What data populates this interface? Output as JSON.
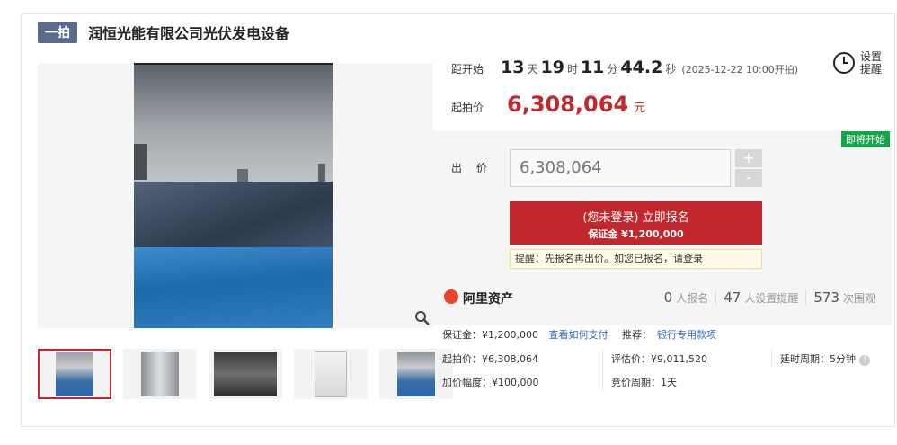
{
  "header": {
    "badge": "一拍",
    "title": "润恒光能有限公司光伏发电设备"
  },
  "countdown": {
    "label": "距开始",
    "days": "13",
    "days_unit": "天",
    "hours": "19",
    "hours_unit": "时",
    "minutes": "11",
    "minutes_unit": "分",
    "seconds": "44.2",
    "seconds_unit": "秒",
    "start_time": "(2025-12-22 10:00开拍)"
  },
  "reminder": {
    "line1": "设置",
    "line2": "提醒"
  },
  "start_price": {
    "label": "起拍价",
    "value": "6,308,064",
    "unit": "元"
  },
  "bid": {
    "status_badge": "即将开始",
    "label": "出 价",
    "input_value": "6,308,064",
    "plus": "+",
    "minus": "-",
    "signup_line1": "(您未登录) 立即报名",
    "signup_line2": "保证金 ¥1,200,000",
    "tip_text": "提醒：先报名再出价。如您已报名，请",
    "tip_link": "登录"
  },
  "platform": {
    "name": "阿里资产",
    "signups_count": "0",
    "signups_label": "人报名",
    "reminders_count": "47",
    "reminders_label": "人设置提醒",
    "views_count": "573",
    "views_label": "次围观"
  },
  "details": {
    "deposit": "保证金：¥1,200,000",
    "how_to_pay": "查看如何支付",
    "recommend_label": "推荐：",
    "recommend_link": "银行专用款项",
    "start_price": "起拍价：¥6,308,064",
    "appraisal": "评估价：¥9,011,520",
    "extension": "延时周期：5分钟",
    "increment": "加价幅度：¥100,000",
    "bid_period": "竞价周期：1天"
  },
  "colors": {
    "accent": "#c1272d",
    "badge": "#5a6b8c",
    "status": "#16a34a",
    "link": "#2f6bbd"
  }
}
